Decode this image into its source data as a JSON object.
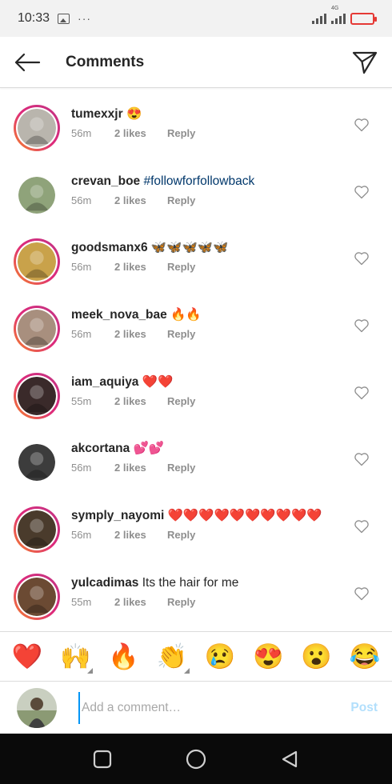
{
  "status_bar": {
    "time": "10:33",
    "icons": [
      "gallery-icon",
      "more-dots-icon",
      "signal-icon",
      "battery-low-icon"
    ],
    "network_label": "4G",
    "battery_color": "#e53935"
  },
  "header": {
    "title": "Comments",
    "back_icon": "arrow-left-icon",
    "share_icon": "paper-plane-icon"
  },
  "comments": [
    {
      "username": "tumexxjr",
      "text": "😍",
      "time": "56m",
      "likes": "2 likes",
      "reply": "Reply",
      "has_story_ring": true,
      "avatar_color": "#b9b5ad"
    },
    {
      "username": "crevan_boe",
      "text": "#followforfollowback",
      "is_hashtag": true,
      "time": "56m",
      "likes": "2 likes",
      "reply": "Reply",
      "has_story_ring": false,
      "avatar_color": "#8fa37a"
    },
    {
      "username": "goodsmanx6",
      "text": "🦋🦋🦋🦋🦋",
      "time": "56m",
      "likes": "2 likes",
      "reply": "Reply",
      "has_story_ring": true,
      "avatar_color": "#c9a24a"
    },
    {
      "username": "meek_nova_bae",
      "text": "🔥🔥",
      "time": "56m",
      "likes": "2 likes",
      "reply": "Reply",
      "has_story_ring": true,
      "avatar_color": "#a88f7e"
    },
    {
      "username": "iam_aquiya",
      "text": "❤️❤️",
      "time": "55m",
      "likes": "2 likes",
      "reply": "Reply",
      "has_story_ring": true,
      "avatar_color": "#3a2a2a"
    },
    {
      "username": "akcortana",
      "text": "💕💕",
      "time": "56m",
      "likes": "2 likes",
      "reply": "Reply",
      "has_story_ring": false,
      "avatar_color": "#3c3c3c"
    },
    {
      "username": "symply_nayomi",
      "text": "❤️❤️❤️❤️❤️❤️❤️❤️❤️❤️",
      "time": "56m",
      "likes": "2 likes",
      "reply": "Reply",
      "has_story_ring": true,
      "avatar_color": "#4a3b2c"
    },
    {
      "username": "yulcadimas",
      "text": "Its the hair for me",
      "time": "55m",
      "likes": "2 likes",
      "reply": "Reply",
      "has_story_ring": true,
      "avatar_color": "#6b4a33"
    }
  ],
  "emoji_bar": [
    {
      "emoji": "❤️",
      "has_variants": false
    },
    {
      "emoji": "🙌",
      "has_variants": true
    },
    {
      "emoji": "🔥",
      "has_variants": false
    },
    {
      "emoji": "👏",
      "has_variants": true
    },
    {
      "emoji": "😢",
      "has_variants": false
    },
    {
      "emoji": "😍",
      "has_variants": false
    },
    {
      "emoji": "😮",
      "has_variants": false
    },
    {
      "emoji": "😂",
      "has_variants": false
    }
  ],
  "composer": {
    "placeholder": "Add a comment…",
    "post_label": "Post",
    "avatar_color": "#7a8a6a"
  },
  "nav_bar": {
    "icons": [
      "recent-apps-icon",
      "home-icon",
      "back-triangle-icon"
    ]
  },
  "colors": {
    "story_ring_start": "#f58529",
    "story_ring_end": "#c13584",
    "hashtag": "#00376b",
    "post_disabled": "#b2dffc",
    "meta_gray": "#8e8e8e"
  }
}
